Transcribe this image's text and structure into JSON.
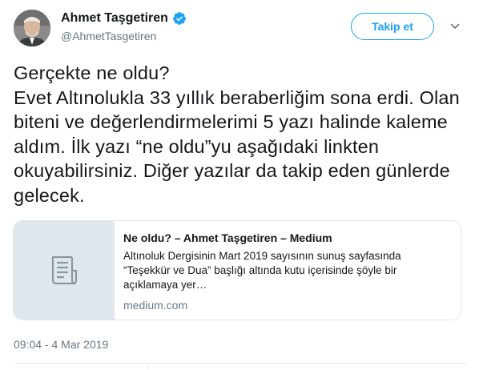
{
  "user": {
    "display_name": "Ahmet Taşgetiren",
    "handle": "@AhmetTasgetiren",
    "verified": true
  },
  "follow_button": {
    "label": "Takip et"
  },
  "tweet": {
    "text": "Gerçekte ne oldu?\nEvet Altınolukla 33 yıllık beraberliğim sona erdi. Olan biteni ve değerlendirmelerimi 5 yazı halinde kaleme aldım. İlk yazı “ne oldu”yu aşağıdaki linkten okuyabilirsiniz. Diğer yazılar da takip eden günlerde gelecek."
  },
  "card": {
    "title": "Ne oldu? – Ahmet Taşgetiren – Medium",
    "description": "Altınoluk Dergisinin Mart 2019 sayısının sunuş sayfasında “Teşekkür ve Dua” başlığı altında kutu içerisinde şöyle bir açıklamaya yer…",
    "domain": "medium.com",
    "thumbnail_icon": "document-icon"
  },
  "timestamp": "09:04 - 4 Mar 2019",
  "colors": {
    "accent": "#1da1f2",
    "text": "#14171a",
    "secondary_text": "#657786",
    "border": "#e1e8ed"
  }
}
